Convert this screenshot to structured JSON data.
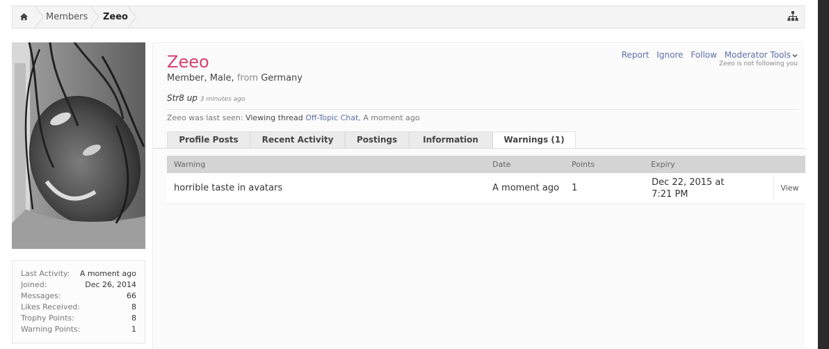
{
  "breadcrumb": {
    "home_icon": "home-icon",
    "items": [
      "Members",
      "Zeeo"
    ],
    "sitemap_icon": "sitemap-icon"
  },
  "stats": [
    {
      "label": "Last Activity:",
      "value": "A moment ago"
    },
    {
      "label": "Joined:",
      "value": "Dec 26, 2014"
    },
    {
      "label": "Messages:",
      "value": "66"
    },
    {
      "label": "Likes Received:",
      "value": "8"
    },
    {
      "label": "Trophy Points:",
      "value": "8"
    },
    {
      "label": "Warning Points:",
      "value": "1"
    }
  ],
  "profile": {
    "username": "Zeeo",
    "title_prefix": "Member, Male,",
    "from_label": "from",
    "location": "Germany",
    "status": "Str8 up",
    "status_time": "3 minutes ago",
    "last_seen_prefix": "Zeeo was last seen:",
    "last_seen_action": "Viewing thread",
    "last_seen_thread": "Off-Topic Chat",
    "last_seen_time": ", A moment ago",
    "name_color": "#d6416d",
    "link_color": "#5c6fa8"
  },
  "actions": {
    "report": "Report",
    "ignore": "Ignore",
    "follow": "Follow",
    "moderator_tools": "Moderator Tools",
    "following_note": "Zeeo is not following you"
  },
  "tabs": [
    "Profile Posts",
    "Recent Activity",
    "Postings",
    "Information",
    "Warnings (1)"
  ],
  "active_tab": "Warnings (1)",
  "warnings": {
    "headers": [
      "Warning",
      "Date",
      "Points",
      "Expiry"
    ],
    "rows": [
      {
        "warning": "horrible taste in avatars",
        "date": "A moment ago",
        "points": "1",
        "expiry_line1": "Dec 22, 2015 at",
        "expiry_line2": "7:21 PM",
        "action": "View"
      }
    ]
  }
}
